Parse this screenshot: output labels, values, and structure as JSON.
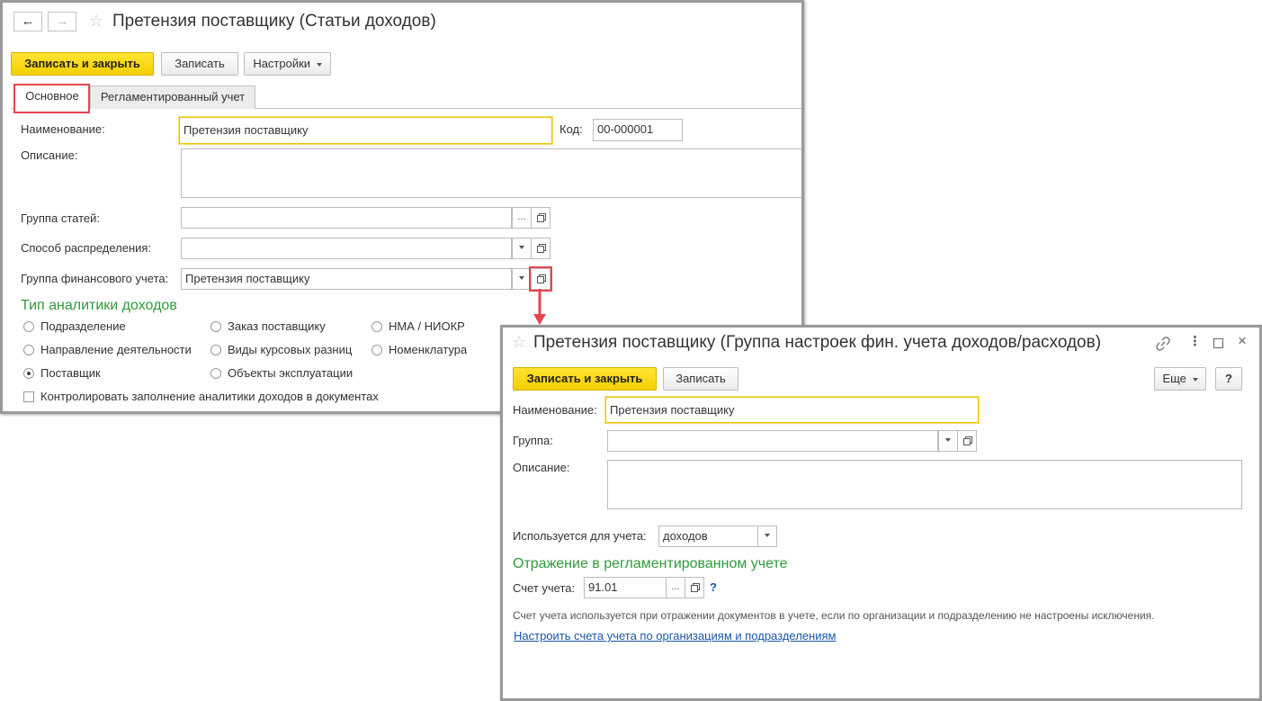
{
  "win1": {
    "title": "Претензия поставщику (Статьи доходов)",
    "nav_back": "←",
    "nav_forward": "→",
    "toolbar": {
      "save_close": "Записать и закрыть",
      "save": "Записать",
      "settings": "Настройки"
    },
    "tabs": [
      "Основное",
      "Регламентированный учет"
    ],
    "fields": {
      "name_label": "Наименование:",
      "name_value": "Претензия поставщику",
      "code_label": "Код:",
      "code_value": "00-000001",
      "desc_label": "Описание:",
      "desc_value": "",
      "group_label": "Группа статей:",
      "group_value": "",
      "dist_label": "Способ распределения:",
      "dist_value": "",
      "fin_group_label": "Группа финансового учета:",
      "fin_group_value": "Претензия поставщику"
    },
    "analytics_title": "Тип аналитики доходов",
    "radios": [
      [
        "Подразделение",
        "Заказ поставщику",
        "НМА / НИОКР"
      ],
      [
        "Направление деятельности",
        "Виды курсовых разниц",
        "Номенклатура"
      ],
      [
        "Поставщик",
        "Объекты эксплуатации",
        ""
      ]
    ],
    "selected_radio": "Поставщик",
    "checkbox_label": "Контролировать заполнение аналитики доходов в документах"
  },
  "win2": {
    "title": "Претензия поставщику (Группа настроек фин. учета доходов/расходов)",
    "toolbar": {
      "save_close": "Записать и закрыть",
      "save": "Записать",
      "more": "Еще",
      "help": "?"
    },
    "fields": {
      "name_label": "Наименование:",
      "name_value": "Претензия поставщику",
      "group_label": "Группа:",
      "group_value": "",
      "desc_label": "Описание:",
      "desc_value": "",
      "used_for_label": "Используется для учета:",
      "used_for_value": "доходов"
    },
    "section_title": "Отражение в регламентированном учете",
    "account_label": "Счет учета:",
    "account_value": "91.01",
    "account_help": "?",
    "hint": "Счет учета используется при отражении документов в учете, если по организации и подразделению не настроены исключения.",
    "link": "Настроить счета учета по организациям и подразделениям"
  },
  "colors": {
    "primary_button": "#f5cf00",
    "section_green": "#2f9a3b",
    "highlight_red": "#e8454f",
    "link_blue": "#1a56a8"
  }
}
